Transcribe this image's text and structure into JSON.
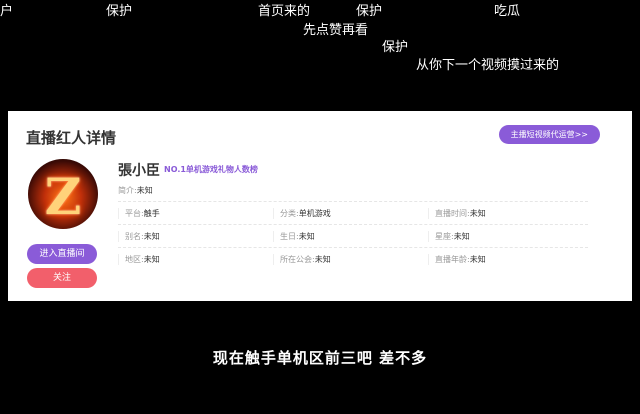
{
  "danmaku": [
    "户",
    "保护",
    "首页来的",
    "保护",
    "吃瓜",
    "先点赞再看",
    "保护",
    "从你下一个视频摸过来的"
  ],
  "card": {
    "title": "直播红人详情",
    "agency_button": "主播短视频代运营>>"
  },
  "profile": {
    "name": "張小臣",
    "rank_tag": "NO.1单机游戏礼物人数榜",
    "intro_label": "简介:",
    "intro_value": "未知",
    "avatar_letter": "Z"
  },
  "info": [
    [
      {
        "label": "平台:",
        "value": "触手"
      },
      {
        "label": "分类:",
        "value": "单机游戏"
      },
      {
        "label": "直播时间:",
        "value": "未知"
      }
    ],
    [
      {
        "label": "别名:",
        "value": "未知"
      },
      {
        "label": "生日:",
        "value": "未知"
      },
      {
        "label": "星座:",
        "value": "未知"
      }
    ],
    [
      {
        "label": "地区:",
        "value": "未知"
      },
      {
        "label": "所在公会:",
        "value": "未知"
      },
      {
        "label": "直播年龄:",
        "value": "未知"
      }
    ]
  ],
  "actions": {
    "enter_live": "进入直播间",
    "follow": "关注"
  },
  "subtitle": "现在触手单机区前三吧 差不多",
  "colors": {
    "accent_purple": "#8a5bd8",
    "follow_red": "#f25f6b",
    "background": "#000000"
  }
}
